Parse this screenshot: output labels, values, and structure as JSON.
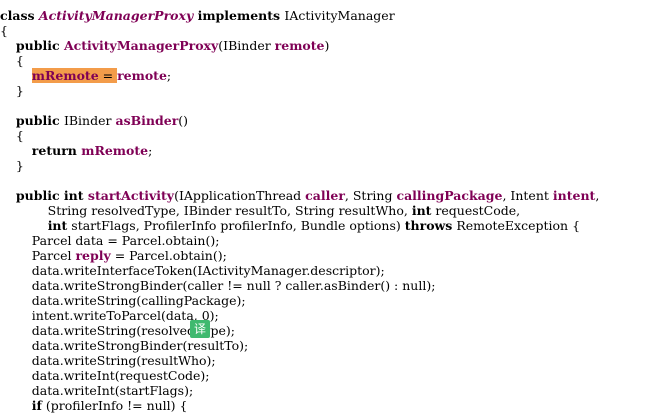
{
  "lines": [
    {
      "t": "class ",
      "a": "ActivityManagerProxy",
      "b": " implements ",
      "c": "IActivityManager"
    },
    {
      "t": "{"
    },
    {
      "t": "    ",
      "a": "public ",
      "b": "ActivityManagerProxy",
      "c": "(IBinder ",
      "d": "remote",
      "e": ")"
    },
    {
      "t": "    {"
    },
    {
      "t": "        ",
      "a": "mRemote",
      "b": " = ",
      "c": "remote",
      "d": ";"
    },
    {
      "t": "    }"
    },
    {
      "t": ""
    },
    {
      "t": "    ",
      "a": "public ",
      "b": "IBinder ",
      "c": "asBinder",
      "d": "()"
    },
    {
      "t": "    {"
    },
    {
      "t": "        ",
      "a": "return ",
      "b": "mRemote",
      "c": ";"
    },
    {
      "t": "    }"
    },
    {
      "t": ""
    },
    {
      "t": "    ",
      "a": "public int ",
      "b": "startActivity",
      "c": "(IApplicationThread ",
      "d": "caller",
      "e": ", String ",
      "f": "callingPackage",
      "g": ", Intent ",
      "h": "intent",
      "i": ","
    },
    {
      "t": "            String resolvedType, IBinder resultTo, String resultWho, ",
      "a": "int",
      "b": " requestCode,"
    },
    {
      "t": "            ",
      "a": "int",
      "b": " startFlags, ProfilerInfo profilerInfo, Bundle options) ",
      "c": "throws",
      "d": " RemoteException {"
    },
    {
      "t": "        Parcel data = Parcel.obtain();"
    },
    {
      "t": "        Parcel ",
      "a": "reply",
      "b": " = Parcel.obtain();"
    },
    {
      "t": "        data.writeInterfaceToken(IActivityManager.descriptor);"
    },
    {
      "t": "        data.writeStrongBinder(caller != null ? caller.asBinder() : null);"
    },
    {
      "t": "        data.writeString(callingPackage);"
    },
    {
      "t": "        intent.writeToParcel(data, 0);"
    },
    {
      "t": "        data.writeString(resolvedType);"
    },
    {
      "t": "        data.writeStrongBinder(resultTo);"
    },
    {
      "t": "        data.writeString(resultWho);"
    },
    {
      "t": "        data.writeInt(requestCode);"
    },
    {
      "t": "        data.writeInt(startFlags);"
    },
    {
      "t": "        ",
      "a": "if",
      "b": " (profilerInfo != null) {"
    }
  ],
  "badge": "译"
}
